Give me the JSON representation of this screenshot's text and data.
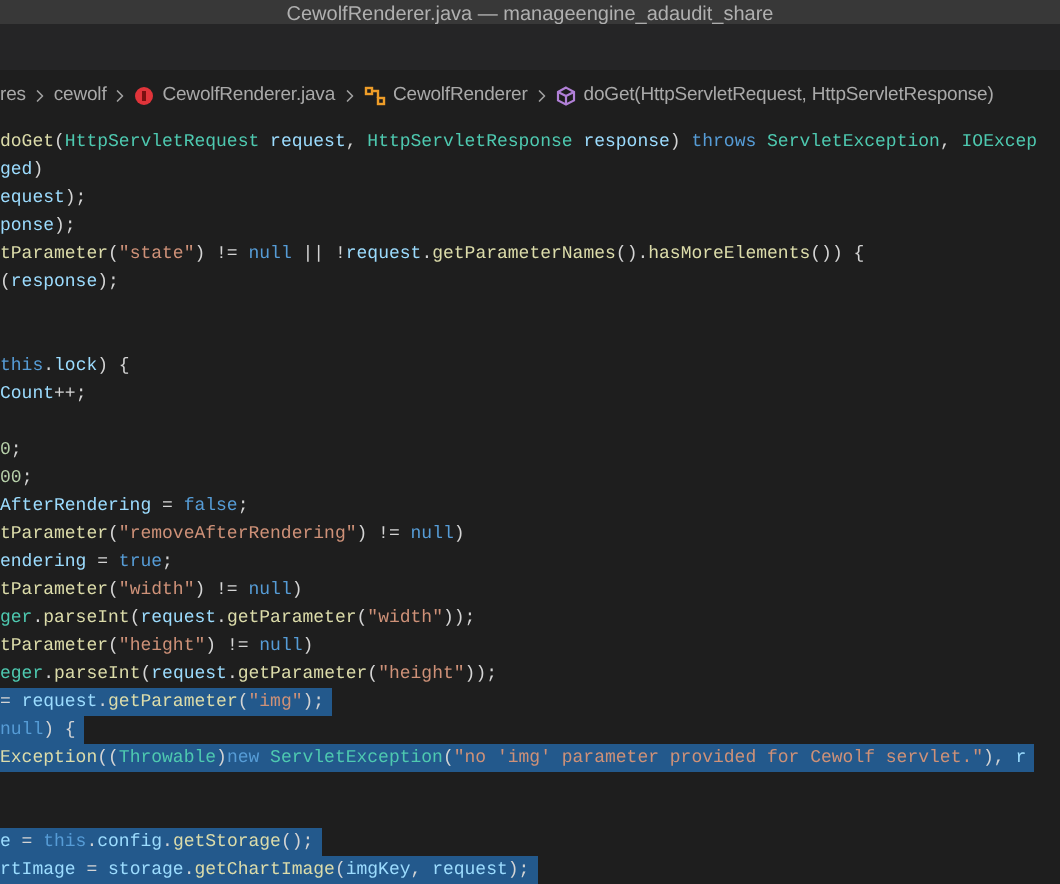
{
  "window": {
    "title": "CewolfRenderer.java — manageengine_adaudit_share"
  },
  "breadcrumb": [
    {
      "kind": "folder",
      "label": "res"
    },
    {
      "kind": "folder",
      "label": "cewolf"
    },
    {
      "kind": "file",
      "label": "CewolfRenderer.java"
    },
    {
      "kind": "class",
      "label": "CewolfRenderer"
    },
    {
      "kind": "method",
      "label": "doGet(HttpServletRequest, HttpServletResponse)"
    }
  ],
  "code_lines": [
    {
      "kind": "code",
      "selected": false,
      "tokens": [
        {
          "kind": "fn",
          "text": "doGet"
        },
        {
          "kind": "plain",
          "text": "("
        },
        {
          "kind": "type",
          "text": "HttpServletRequest"
        },
        {
          "kind": "var",
          "text": " request"
        },
        {
          "kind": "plain",
          "text": ", "
        },
        {
          "kind": "type",
          "text": "HttpServletResponse"
        },
        {
          "kind": "var",
          "text": " response"
        },
        {
          "kind": "plain",
          "text": ") "
        },
        {
          "kind": "kw",
          "text": "throws"
        },
        {
          "kind": "type",
          "text": " ServletException"
        },
        {
          "kind": "plain",
          "text": ", "
        },
        {
          "kind": "type",
          "text": "IOExcep"
        }
      ]
    },
    {
      "kind": "code",
      "selected": false,
      "tokens": [
        {
          "kind": "var",
          "text": "ged"
        },
        {
          "kind": "plain",
          "text": ")"
        }
      ]
    },
    {
      "kind": "code",
      "selected": false,
      "tokens": [
        {
          "kind": "var",
          "text": "equest"
        },
        {
          "kind": "plain",
          "text": ");"
        }
      ]
    },
    {
      "kind": "code",
      "selected": false,
      "tokens": [
        {
          "kind": "var",
          "text": "ponse"
        },
        {
          "kind": "plain",
          "text": ");"
        }
      ]
    },
    {
      "kind": "code",
      "selected": false,
      "tokens": [
        {
          "kind": "fn",
          "text": "tParameter"
        },
        {
          "kind": "plain",
          "text": "("
        },
        {
          "kind": "str",
          "text": "\"state\""
        },
        {
          "kind": "plain",
          "text": ") != "
        },
        {
          "kind": "kw",
          "text": "null"
        },
        {
          "kind": "plain",
          "text": " || !"
        },
        {
          "kind": "var",
          "text": "request"
        },
        {
          "kind": "plain",
          "text": "."
        },
        {
          "kind": "fn",
          "text": "getParameterNames"
        },
        {
          "kind": "plain",
          "text": "()."
        },
        {
          "kind": "fn",
          "text": "hasMoreElements"
        },
        {
          "kind": "plain",
          "text": "()) {"
        }
      ]
    },
    {
      "kind": "code",
      "selected": false,
      "tokens": [
        {
          "kind": "plain",
          "text": "("
        },
        {
          "kind": "var",
          "text": "response"
        },
        {
          "kind": "plain",
          "text": ");"
        }
      ]
    },
    {
      "kind": "blank"
    },
    {
      "kind": "blank"
    },
    {
      "kind": "code",
      "selected": false,
      "tokens": [
        {
          "kind": "kw",
          "text": "this"
        },
        {
          "kind": "plain",
          "text": "."
        },
        {
          "kind": "var",
          "text": "lock"
        },
        {
          "kind": "plain",
          "text": ") {"
        }
      ]
    },
    {
      "kind": "code",
      "selected": false,
      "tokens": [
        {
          "kind": "var",
          "text": "Count"
        },
        {
          "kind": "plain",
          "text": "++;"
        }
      ]
    },
    {
      "kind": "blank"
    },
    {
      "kind": "code",
      "selected": false,
      "tokens": [
        {
          "kind": "num",
          "text": "0"
        },
        {
          "kind": "plain",
          "text": ";"
        }
      ]
    },
    {
      "kind": "code",
      "selected": false,
      "tokens": [
        {
          "kind": "num",
          "text": "00"
        },
        {
          "kind": "plain",
          "text": ";"
        }
      ]
    },
    {
      "kind": "code",
      "selected": false,
      "tokens": [
        {
          "kind": "var",
          "text": "AfterRendering"
        },
        {
          "kind": "plain",
          "text": " = "
        },
        {
          "kind": "kw",
          "text": "false"
        },
        {
          "kind": "plain",
          "text": ";"
        }
      ]
    },
    {
      "kind": "code",
      "selected": false,
      "tokens": [
        {
          "kind": "fn",
          "text": "tParameter"
        },
        {
          "kind": "plain",
          "text": "("
        },
        {
          "kind": "str",
          "text": "\"removeAfterRendering\""
        },
        {
          "kind": "plain",
          "text": ") != "
        },
        {
          "kind": "kw",
          "text": "null"
        },
        {
          "kind": "plain",
          "text": ")"
        }
      ]
    },
    {
      "kind": "code",
      "selected": false,
      "tokens": [
        {
          "kind": "var",
          "text": "endering"
        },
        {
          "kind": "plain",
          "text": " = "
        },
        {
          "kind": "kw",
          "text": "true"
        },
        {
          "kind": "plain",
          "text": ";"
        }
      ]
    },
    {
      "kind": "code",
      "selected": false,
      "tokens": [
        {
          "kind": "fn",
          "text": "tParameter"
        },
        {
          "kind": "plain",
          "text": "("
        },
        {
          "kind": "str",
          "text": "\"width\""
        },
        {
          "kind": "plain",
          "text": ") != "
        },
        {
          "kind": "kw",
          "text": "null"
        },
        {
          "kind": "plain",
          "text": ")"
        }
      ]
    },
    {
      "kind": "code",
      "selected": false,
      "tokens": [
        {
          "kind": "type",
          "text": "ger"
        },
        {
          "kind": "plain",
          "text": "."
        },
        {
          "kind": "fn",
          "text": "parseInt"
        },
        {
          "kind": "plain",
          "text": "("
        },
        {
          "kind": "var",
          "text": "request"
        },
        {
          "kind": "plain",
          "text": "."
        },
        {
          "kind": "fn",
          "text": "getParameter"
        },
        {
          "kind": "plain",
          "text": "("
        },
        {
          "kind": "str",
          "text": "\"width\""
        },
        {
          "kind": "plain",
          "text": "));"
        }
      ]
    },
    {
      "kind": "code",
      "selected": false,
      "tokens": [
        {
          "kind": "fn",
          "text": "tParameter"
        },
        {
          "kind": "plain",
          "text": "("
        },
        {
          "kind": "str",
          "text": "\"height\""
        },
        {
          "kind": "plain",
          "text": ") != "
        },
        {
          "kind": "kw",
          "text": "null"
        },
        {
          "kind": "plain",
          "text": ")"
        }
      ]
    },
    {
      "kind": "code",
      "selected": false,
      "tokens": [
        {
          "kind": "type",
          "text": "eger"
        },
        {
          "kind": "plain",
          "text": "."
        },
        {
          "kind": "fn",
          "text": "parseInt"
        },
        {
          "kind": "plain",
          "text": "("
        },
        {
          "kind": "var",
          "text": "request"
        },
        {
          "kind": "plain",
          "text": "."
        },
        {
          "kind": "fn",
          "text": "getParameter"
        },
        {
          "kind": "plain",
          "text": "("
        },
        {
          "kind": "str",
          "text": "\"height\""
        },
        {
          "kind": "plain",
          "text": "));"
        }
      ]
    },
    {
      "kind": "code",
      "selected": true,
      "tokens": [
        {
          "kind": "plain",
          "text": "= "
        },
        {
          "kind": "var",
          "text": "request"
        },
        {
          "kind": "plain",
          "text": "."
        },
        {
          "kind": "fn",
          "text": "getParameter"
        },
        {
          "kind": "plain",
          "text": "("
        },
        {
          "kind": "str",
          "text": "\"img\""
        },
        {
          "kind": "plain",
          "text": ");"
        }
      ]
    },
    {
      "kind": "code",
      "selected": true,
      "tokens": [
        {
          "kind": "kw",
          "text": "null"
        },
        {
          "kind": "plain",
          "text": ") {"
        }
      ]
    },
    {
      "kind": "code",
      "selected": true,
      "tokens": [
        {
          "kind": "fn",
          "text": "Exception"
        },
        {
          "kind": "plain",
          "text": "(("
        },
        {
          "kind": "type",
          "text": "Throwable"
        },
        {
          "kind": "plain",
          "text": ")"
        },
        {
          "kind": "kw",
          "text": "new"
        },
        {
          "kind": "type",
          "text": " ServletException"
        },
        {
          "kind": "plain",
          "text": "("
        },
        {
          "kind": "str",
          "text": "\"no 'img' parameter provided for Cewolf servlet.\""
        },
        {
          "kind": "plain",
          "text": "), "
        },
        {
          "kind": "var",
          "text": "r"
        }
      ]
    },
    {
      "kind": "blank"
    },
    {
      "kind": "blank"
    },
    {
      "kind": "code",
      "selected": true,
      "tokens": [
        {
          "kind": "var",
          "text": "e"
        },
        {
          "kind": "plain",
          "text": " = "
        },
        {
          "kind": "kw",
          "text": "this"
        },
        {
          "kind": "plain",
          "text": "."
        },
        {
          "kind": "var",
          "text": "config"
        },
        {
          "kind": "plain",
          "text": "."
        },
        {
          "kind": "fn",
          "text": "getStorage"
        },
        {
          "kind": "plain",
          "text": "();"
        }
      ]
    },
    {
      "kind": "code",
      "selected": true,
      "tokens": [
        {
          "kind": "var",
          "text": "rtImage"
        },
        {
          "kind": "plain",
          "text": " = "
        },
        {
          "kind": "var",
          "text": "storage"
        },
        {
          "kind": "plain",
          "text": "."
        },
        {
          "kind": "fn",
          "text": "getChartImage"
        },
        {
          "kind": "plain",
          "text": "("
        },
        {
          "kind": "var",
          "text": "imgKey"
        },
        {
          "kind": "plain",
          "text": ", "
        },
        {
          "kind": "var",
          "text": "request"
        },
        {
          "kind": "plain",
          "text": ");"
        }
      ]
    }
  ]
}
